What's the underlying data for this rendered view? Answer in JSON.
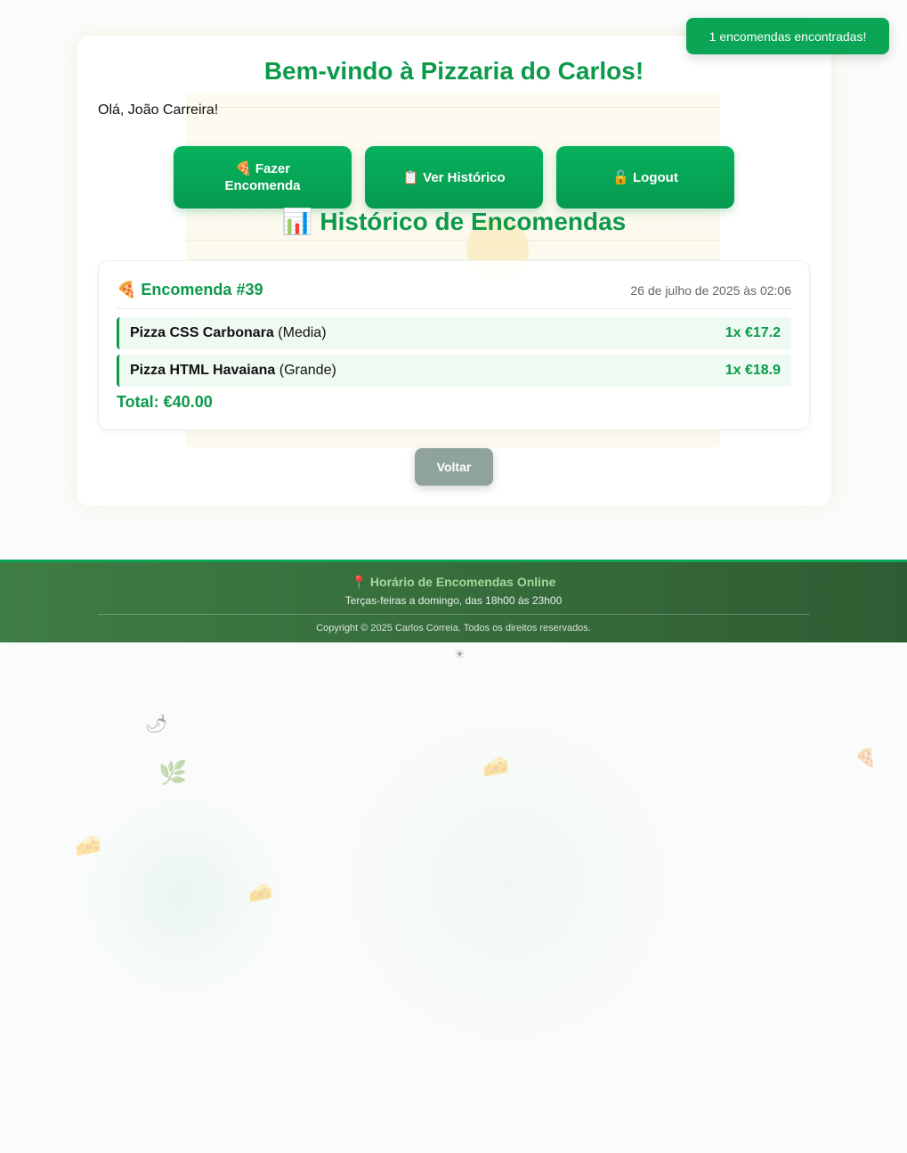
{
  "toast": {
    "message": "1 encomendas encontradas!"
  },
  "header": {
    "welcome": "Bem-vindo à Pizzaria do Carlos!",
    "greeting": "Olá, João Carreira!"
  },
  "nav": {
    "order_label": "🍕 Fazer Encomenda",
    "history_label": "📋 Ver Histórico",
    "logout_label": "🔓 Logout"
  },
  "history": {
    "title": "📊 Histórico de Encomendas",
    "orders": [
      {
        "title": "🍕 Encomenda #39",
        "date": "26 de julho de 2025 às 02:06",
        "items": [
          {
            "name": "Pizza CSS Carbonara",
            "size": "(Media)",
            "qty_price": "1x €17.2"
          },
          {
            "name": "Pizza HTML Havaiana",
            "size": "(Grande)",
            "qty_price": "1x €18.9"
          }
        ],
        "total": "Total: €40.00"
      }
    ],
    "back_label": "Voltar"
  },
  "footer": {
    "hours_title": "📍 Horário de Encomendas Online",
    "hours_text": "Terças-feiras a domingo, das 18h00 às 23h00",
    "copyright": "Copyright © 2025 Carlos Correia. Todos os direitos reservados."
  },
  "colors": {
    "brand_green": "#0b9a4a",
    "toast_bg": "#0aa555",
    "footer_bg": "#2f5d33",
    "back_button": "#8fa39c"
  },
  "decorations": [
    "pizza-slice-icon",
    "chili-icon",
    "basil-leaf-icon",
    "cheese-icon",
    "sun-icon"
  ]
}
